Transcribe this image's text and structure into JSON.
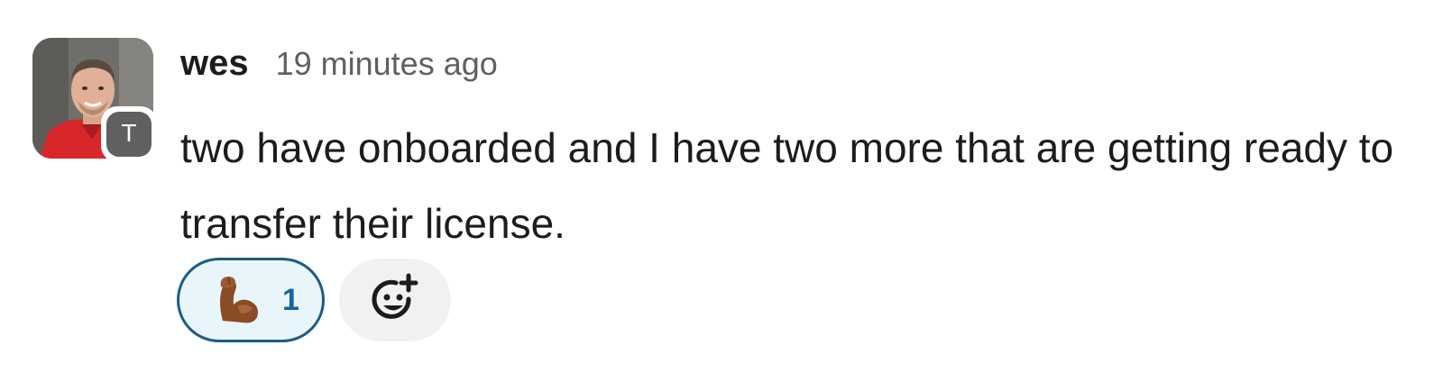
{
  "message": {
    "author": "wes",
    "timestamp": "19 minutes ago",
    "text": "two have onboarded and I have two more that are getting ready to transfer their license.",
    "team_badge_letter": "T"
  },
  "reactions": [
    {
      "emoji": "flexed-biceps-icon",
      "count": "1",
      "selected": true
    }
  ],
  "add_reaction": {
    "icon": "add-reaction-icon"
  },
  "colors": {
    "reaction_border": "#1d5b86",
    "reaction_bg": "#e8f5fa",
    "reaction_count": "#1264a3",
    "badge_bg": "#616061"
  }
}
